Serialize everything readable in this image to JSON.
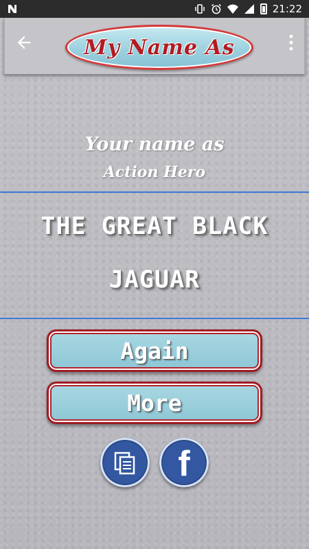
{
  "status_bar": {
    "time": "21:22",
    "icons": [
      "notification-n-icon",
      "vibrate-icon",
      "alarm-icon",
      "wifi-icon",
      "signal-icon",
      "battery-icon"
    ]
  },
  "toolbar": {
    "logo_text": "My Name As",
    "back_icon": "arrow-back-icon",
    "menu_icon": "more-vert-icon"
  },
  "main": {
    "heading_line1": "Your name as",
    "heading_line2": "Action Hero",
    "result_line1": "THE GREAT BLACK",
    "result_line2": "JAGUAR"
  },
  "actions": {
    "again_label": "Again",
    "more_label": "More"
  },
  "share": {
    "copy_icon": "copy-icon",
    "facebook_icon": "facebook-icon",
    "facebook_letter": "f"
  },
  "colors": {
    "status_bar": "#2c2c2c",
    "divider_blue": "#3d78d6",
    "button_fill": "#8ec6d5",
    "button_border": "#9f1b22",
    "circle_blue": "#3357a0"
  }
}
